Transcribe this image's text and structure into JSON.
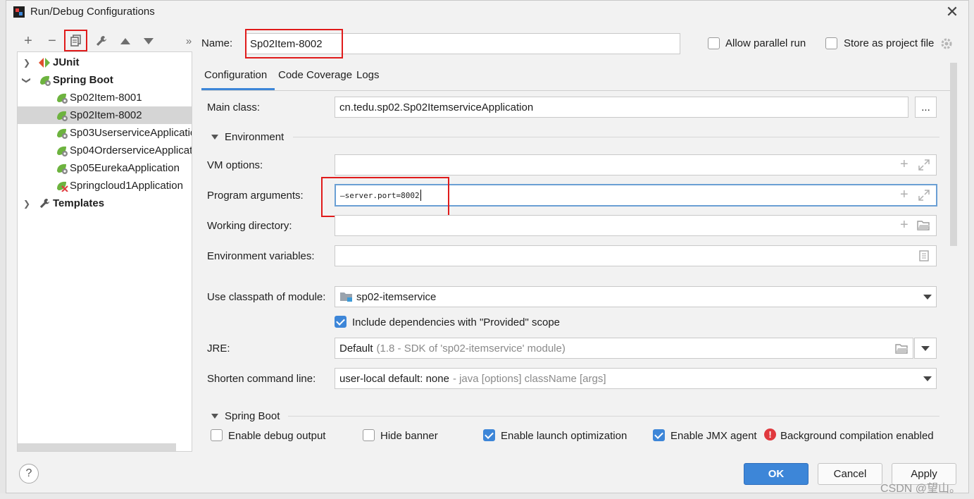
{
  "window": {
    "title": "Run/Debug Configurations"
  },
  "toolbar": {
    "add": "+",
    "remove": "−",
    "more": "»"
  },
  "tree": {
    "items": [
      {
        "label": "JUnit"
      },
      {
        "label": "Spring Boot"
      },
      {
        "label": "Sp02Item-8001"
      },
      {
        "label": "Sp02Item-8002"
      },
      {
        "label": "Sp03UserserviceApplicatio"
      },
      {
        "label": "Sp04OrderserviceApplicati"
      },
      {
        "label": "Sp05EurekaApplication"
      },
      {
        "label": "Springcloud1Application"
      },
      {
        "label": "Templates"
      }
    ]
  },
  "header": {
    "name_label": "Name:",
    "name_value": "Sp02Item-8002",
    "allow_parallel": "Allow parallel run",
    "store_project": "Store as project file"
  },
  "tabs": [
    "Configuration",
    "Code Coverage",
    "Logs"
  ],
  "form": {
    "main_class_label": "Main class:",
    "main_class_value": "cn.tedu.sp02.Sp02ItemserviceApplication",
    "browse": "...",
    "environment": "Environment",
    "vm_options_label": "VM options:",
    "program_args_label": "Program arguments:",
    "program_args_value": "—server.port=8002",
    "working_dir_label": "Working directory:",
    "env_vars_label": "Environment variables:",
    "classpath_label": "Use classpath of module:",
    "classpath_value": "sp02-itemservice",
    "include_deps": "Include dependencies with \"Provided\" scope",
    "jre_label": "JRE:",
    "jre_value": "Default",
    "jre_detail": "(1.8 - SDK of 'sp02-itemservice' module)",
    "shorten_label": "Shorten command line:",
    "shorten_value": "user-local default: none",
    "shorten_detail": "- java [options] className [args]",
    "spring_boot": "Spring Boot",
    "debug_output": "Enable debug output",
    "hide_banner": "Hide banner",
    "launch_opt": "Enable launch optimization",
    "jmx_agent": "Enable JMX agent",
    "bg_compilation": "Background compilation enabled"
  },
  "buttons": {
    "help": "?",
    "ok": "OK",
    "cancel": "Cancel",
    "apply": "Apply"
  },
  "watermark": "CSDN @望山。",
  "colors": {
    "accent": "#3d86d8",
    "highlight": "#e01b1b",
    "spring": "#6db33f",
    "error": "#e0393e"
  }
}
